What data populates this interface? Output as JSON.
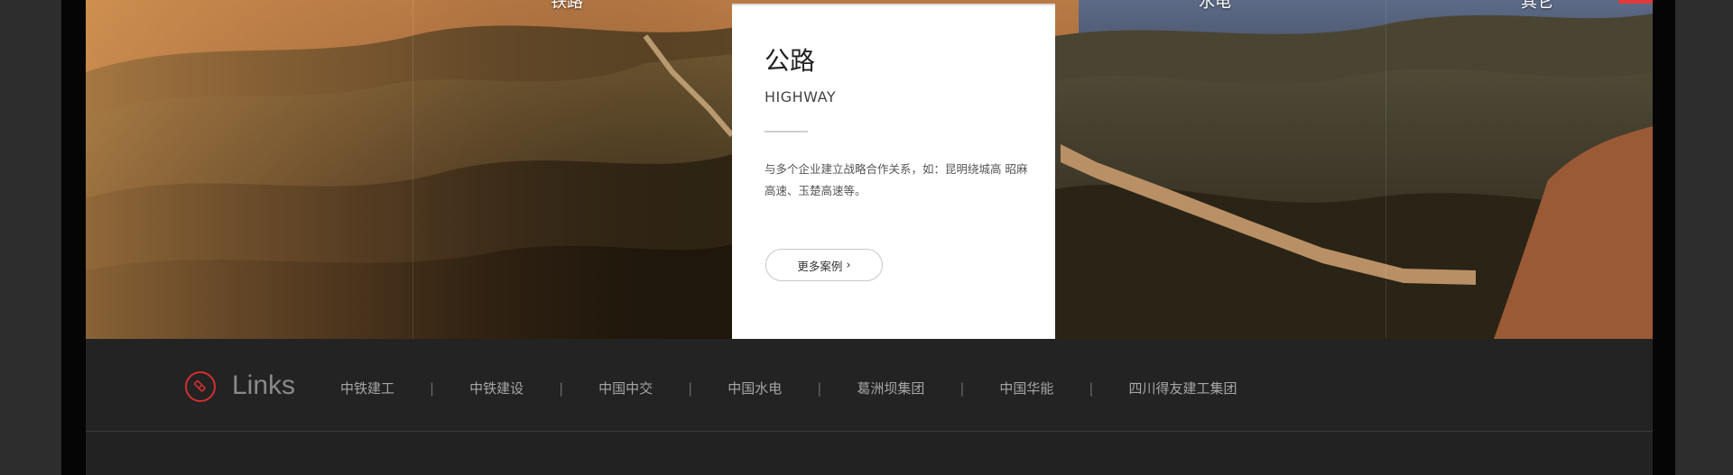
{
  "categories": [
    {
      "label": "铁路"
    },
    {
      "label": "水电"
    },
    {
      "label": "其它"
    }
  ],
  "card": {
    "title": "公路",
    "subtitle": "HIGHWAY",
    "description": "与多个企业建立战略合作关系，如：昆明绕城高 昭麻高速、玉楚高速等。",
    "button_label": "更多案例"
  },
  "links": {
    "title": "Links",
    "items": [
      {
        "label": "中铁建工"
      },
      {
        "label": "中铁建设"
      },
      {
        "label": "中国中交"
      },
      {
        "label": "中国水电"
      },
      {
        "label": "葛洲坝集团"
      },
      {
        "label": "中国华能"
      },
      {
        "label": "四川得友建工集团"
      }
    ],
    "separator": "|"
  },
  "colors": {
    "accent_red": "#d32f2f",
    "links_bg": "#232323",
    "card_bg": "#ffffff"
  },
  "icons": {
    "links": "pencil-in-circle-icon",
    "button_chevron": "chevron-right-icon"
  }
}
